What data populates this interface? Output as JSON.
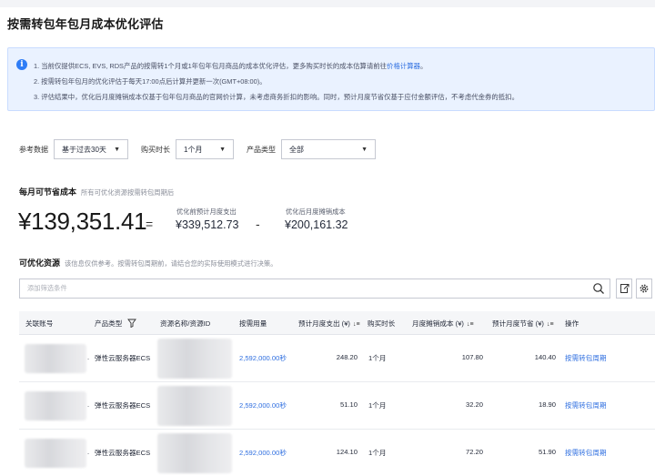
{
  "page": {
    "title": "按需转包年包月成本优化评估"
  },
  "notice": {
    "line1_prefix": "1. 当前仅提供ECS, EVS, RDS产品的按需转1个月或1年包年包月商品的成本优化评估，更多购买时长的成本估算请前往",
    "line1_link": "价格计算器",
    "line1_suffix": "。",
    "line2": "2. 按需转包年包月的优化评估于每天17:00点后计算并更新一次(GMT+08:00)。",
    "line3": "3. 评估结果中，优化后月度摊销成本仅基于包年包月商品的官网价计算，未考虑商务折扣的影响。同时，预计月度节省仅基于应付金额评估，不考虑代金券的抵扣。"
  },
  "filters": {
    "ref_label": "参考数据",
    "ref_value": "基于过去30天",
    "duration_label": "购买时长",
    "duration_value": "1个月",
    "product_label": "产品类型",
    "product_value": "全部"
  },
  "savings": {
    "title": "每月可节省成本",
    "subtitle": "所有可优化资源按需转包周期后",
    "amount": "¥139,351.41",
    "equals": "=",
    "pre_label": "优化前预计月度支出",
    "pre_value": "¥339,512.73",
    "minus": "-",
    "post_label": "优化后月度摊销成本",
    "post_value": "¥200,161.32"
  },
  "resources": {
    "title": "可优化资源",
    "subtitle": "该信息仅供参考。按需转包周期前，请结合您的实际使用模式进行决策。",
    "search_placeholder": "添加筛选条件"
  },
  "table": {
    "headers": {
      "account": "关联账号",
      "product": "产品类型",
      "resource": "资源名称/资源ID",
      "usage": "按需用量",
      "monthly_cost": "预计月度支出 (¥)",
      "duration": "购买时长",
      "amortized": "月度摊销成本 (¥)",
      "saving": "预计月度节省 (¥)",
      "action": "操作"
    },
    "rows": [
      {
        "product": "弹性云服务器ECS",
        "usage": "2,592,000.00秒",
        "monthly_cost": "248.20",
        "duration": "1个月",
        "amortized": "107.80",
        "saving": "140.40",
        "action": "按需转包周期"
      },
      {
        "product": "弹性云服务器ECS",
        "usage": "2,592,000.00秒",
        "monthly_cost": "51.10",
        "duration": "1个月",
        "amortized": "32.20",
        "saving": "18.90",
        "action": "按需转包周期"
      },
      {
        "product": "弹性云服务器ECS",
        "usage": "2,592,000.00秒",
        "monthly_cost": "124.10",
        "duration": "1个月",
        "amortized": "72.20",
        "saving": "51.90",
        "action": "按需转包周期"
      }
    ]
  },
  "icons": {
    "info": "info-circle-icon",
    "search": "search-icon",
    "export": "export-icon",
    "settings": "gear-icon",
    "filter": "filter-icon",
    "sort": "sort-icon",
    "dropdown": "caret-down-icon"
  },
  "colors": {
    "accent": "#2f6fe0",
    "notice_bg": "#eaf2ff",
    "info_icon": "#2f7df6"
  }
}
